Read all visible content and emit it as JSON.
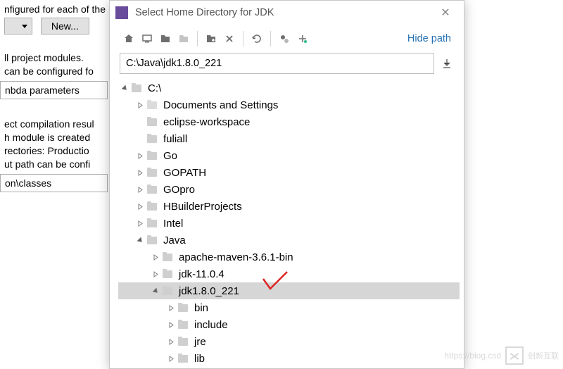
{
  "bg": {
    "line1": "nfigured for each of the",
    "btn_new": "New...",
    "para1a": "ll project modules.",
    "para1b": "can be configured fo",
    "input1": "nbda parameters",
    "para2a": "ect compilation resul",
    "para2b": "h module is created",
    "para2c": "rectories: Productio",
    "para2d": "ut path can be confi",
    "input2": "on\\classes"
  },
  "dialog": {
    "title": "Select Home Directory for JDK",
    "hide_path": "Hide path",
    "path_value": "C:\\Java\\jdk1.8.0_221"
  },
  "tree": {
    "root": "C:\\",
    "items": [
      {
        "label": "Documents and Settings",
        "expandable": true,
        "dim": true
      },
      {
        "label": "eclipse-workspace",
        "expandable": false
      },
      {
        "label": "fuliall",
        "expandable": false
      },
      {
        "label": "Go",
        "expandable": true
      },
      {
        "label": "GOPATH",
        "expandable": true
      },
      {
        "label": "GOpro",
        "expandable": true
      },
      {
        "label": "HBuilderProjects",
        "expandable": true
      },
      {
        "label": "Intel",
        "expandable": true
      }
    ],
    "java": "Java",
    "java_children": [
      {
        "label": "apache-maven-3.6.1-bin",
        "expandable": true
      },
      {
        "label": "jdk-11.0.4",
        "expandable": true
      }
    ],
    "selected": "jdk1.8.0_221",
    "selected_children": [
      {
        "label": "bin",
        "expandable": true
      },
      {
        "label": "include",
        "expandable": true
      },
      {
        "label": "jre",
        "expandable": true
      },
      {
        "label": "lib",
        "expandable": true
      }
    ]
  },
  "watermark": {
    "url": "https://blog.csd",
    "brand": "创新互联"
  }
}
